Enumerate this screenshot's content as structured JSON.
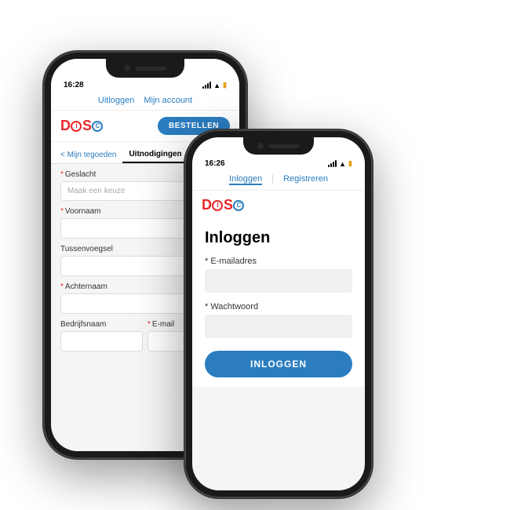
{
  "leftPhone": {
    "statusBar": {
      "time": "16:28",
      "signal": true,
      "wifi": true,
      "battery": "🔋"
    },
    "nav": {
      "logout": "Uitloggen",
      "account": "Mijn account"
    },
    "logo": {
      "text": "DISC",
      "orderButton": "BESTELLEN"
    },
    "tabs": {
      "back": "< Mijn tegoeden",
      "active": "Uitnodigingen"
    },
    "form": {
      "fields": [
        {
          "label": "Geslacht",
          "required": true,
          "placeholder": "Maak een keuze",
          "type": "select"
        },
        {
          "label": "Voornaam",
          "required": true,
          "placeholder": ""
        },
        {
          "label": "Tussenvoegsel",
          "required": false,
          "placeholder": ""
        },
        {
          "label": "Achternaam",
          "required": true,
          "placeholder": ""
        }
      ],
      "bottomRow": [
        {
          "label": "Bedrijfsnaam",
          "required": false,
          "placeholder": ""
        },
        {
          "label": "E-mail",
          "required": true,
          "placeholder": ""
        }
      ]
    }
  },
  "rightPhone": {
    "statusBar": {
      "time": "16:26",
      "signal": true,
      "wifi": true,
      "battery": "🔋"
    },
    "nav": {
      "login": "Inloggen",
      "register": "Registreren"
    },
    "logo": {
      "text": "DISC"
    },
    "loginForm": {
      "title": "Inloggen",
      "emailLabel": "* E-mailadres",
      "passwordLabel": "* Wachtwoord",
      "button": "INLOGGEN"
    }
  }
}
